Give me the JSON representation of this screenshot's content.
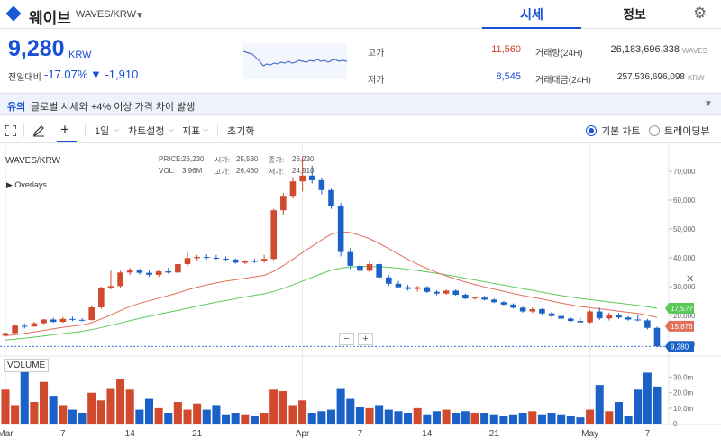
{
  "header": {
    "coin_name": "웨이브",
    "pair": "WAVES/KRW",
    "tabs": [
      {
        "label": "시세"
      },
      {
        "label": "정보"
      }
    ],
    "icons": {
      "coin": "diamond-icon",
      "caret": "caret-down-icon",
      "settings": "gear-icon"
    }
  },
  "ticker": {
    "price": "9,280",
    "unit": "KRW",
    "change_label": "전일대비",
    "change_pct": "-17.07%",
    "change_abs": "▼ -1,910",
    "high_label": "고가",
    "high": "11,560",
    "low_label": "저가",
    "low": "8,545",
    "volume_label": "거래량(24H)",
    "volume": "26,183,696.338",
    "volume_unit": "WAVES",
    "amount_label": "거래대금(24H)",
    "amount": "257,536,696,098",
    "amount_unit": "KRW"
  },
  "notice": {
    "tag": "유의",
    "text": "글로벌 시세와 +4% 이상 가격 차이 발생"
  },
  "toolbar": {
    "interval": "1일",
    "chart_settings": "차트설정",
    "indicators": "지표",
    "reset": "초기화",
    "basic_chart": "기본 차트",
    "tradingview": "트레이딩뷰"
  },
  "legend": {
    "price_label": "PRICE:",
    "price": "26,230",
    "open_label": "시가:",
    "open": "25,530",
    "close_label": "종가:",
    "close": "26,230",
    "vol_label": "VOL:",
    "vol": "3.96M",
    "high_label": "고가:",
    "high": "26,460",
    "low_label": "저가:",
    "low": "24,910"
  },
  "chart_ui": {
    "symbol": "WAVES/KRW",
    "overlays": "▶ Overlays",
    "volume_tag": "VOLUME",
    "zoom_out": "−",
    "zoom_in": "+",
    "close": "✕"
  },
  "chart_data": {
    "type": "candlestick",
    "y_axis": {
      "ticks": [
        10000,
        20000,
        30000,
        40000,
        50000,
        60000,
        70000
      ],
      "tick_labels": [
        "10,000",
        "20,000",
        "30,000",
        "40,000",
        "50,000",
        "60,000",
        "70,000"
      ],
      "range": [
        7500,
        75000
      ]
    },
    "volume_axis": {
      "ticks": [
        10,
        20,
        30
      ],
      "tick_labels": [
        "10.0m",
        "20.0m",
        "30.0m"
      ],
      "range": [
        0,
        35
      ]
    },
    "x_axis": {
      "ticks": [
        {
          "day": 1,
          "label": "Mar"
        },
        {
          "day": 7,
          "label": "7"
        },
        {
          "day": 14,
          "label": "14"
        },
        {
          "day": 21,
          "label": "21"
        },
        {
          "day": 32,
          "label": "Apr"
        },
        {
          "day": 38,
          "label": "7"
        },
        {
          "day": 45,
          "label": "14"
        },
        {
          "day": 52,
          "label": "21"
        },
        {
          "day": 62,
          "label": "May"
        },
        {
          "day": 68,
          "label": "7"
        }
      ]
    },
    "badges": {
      "ma_green": "17,5??",
      "ma_red": "15,876",
      "last": "9,280"
    },
    "colors": {
      "up": "#d14a2e",
      "down": "#1a62c8",
      "ma_short": "#e0705a",
      "ma_long": "#5cc85c",
      "badge_last": "#1a62c8"
    },
    "candles": [
      {
        "o": 13000,
        "h": 14200,
        "l": 12600,
        "c": 13900,
        "v": 22
      },
      {
        "o": 13900,
        "h": 17000,
        "l": 13500,
        "c": 16500,
        "v": 12
      },
      {
        "o": 16400,
        "h": 17200,
        "l": 15500,
        "c": 16200,
        "v": 34
      },
      {
        "o": 16200,
        "h": 17800,
        "l": 16000,
        "c": 17300,
        "v": 14
      },
      {
        "o": 17300,
        "h": 18800,
        "l": 17000,
        "c": 18600,
        "v": 27
      },
      {
        "o": 18600,
        "h": 19200,
        "l": 17500,
        "c": 17800,
        "v": 18
      },
      {
        "o": 17800,
        "h": 19500,
        "l": 17400,
        "c": 18800,
        "v": 12
      },
      {
        "o": 18800,
        "h": 19600,
        "l": 18000,
        "c": 18500,
        "v": 9
      },
      {
        "o": 18500,
        "h": 19000,
        "l": 17900,
        "c": 18400,
        "v": 7
      },
      {
        "o": 18400,
        "h": 23500,
        "l": 18300,
        "c": 22800,
        "v": 20
      },
      {
        "o": 22800,
        "h": 30000,
        "l": 22300,
        "c": 29700,
        "v": 15
      },
      {
        "o": 29700,
        "h": 35500,
        "l": 29000,
        "c": 30200,
        "v": 23
      },
      {
        "o": 30200,
        "h": 35500,
        "l": 29500,
        "c": 34900,
        "v": 29
      },
      {
        "o": 34900,
        "h": 36500,
        "l": 34000,
        "c": 35600,
        "v": 22
      },
      {
        "o": 35600,
        "h": 36200,
        "l": 34200,
        "c": 34800,
        "v": 9
      },
      {
        "o": 34800,
        "h": 35500,
        "l": 33500,
        "c": 34100,
        "v": 16
      },
      {
        "o": 34100,
        "h": 35800,
        "l": 33400,
        "c": 35300,
        "v": 10
      },
      {
        "o": 35300,
        "h": 36500,
        "l": 34500,
        "c": 34900,
        "v": 7
      },
      {
        "o": 34900,
        "h": 38200,
        "l": 34300,
        "c": 37800,
        "v": 14
      },
      {
        "o": 37800,
        "h": 42000,
        "l": 37200,
        "c": 39900,
        "v": 9
      },
      {
        "o": 39900,
        "h": 41000,
        "l": 38800,
        "c": 40300,
        "v": 13
      },
      {
        "o": 40300,
        "h": 41200,
        "l": 39500,
        "c": 40000,
        "v": 9
      },
      {
        "o": 40000,
        "h": 41000,
        "l": 39300,
        "c": 39700,
        "v": 12
      },
      {
        "o": 39700,
        "h": 40500,
        "l": 39000,
        "c": 39400,
        "v": 6
      },
      {
        "o": 39400,
        "h": 39800,
        "l": 38000,
        "c": 38300,
        "v": 7
      },
      {
        "o": 38300,
        "h": 39200,
        "l": 37800,
        "c": 38900,
        "v": 6
      },
      {
        "o": 38900,
        "h": 39600,
        "l": 38200,
        "c": 38800,
        "v": 5
      },
      {
        "o": 38800,
        "h": 41000,
        "l": 38300,
        "c": 39600,
        "v": 7
      },
      {
        "o": 39600,
        "h": 57000,
        "l": 39200,
        "c": 56500,
        "v": 22
      },
      {
        "o": 56500,
        "h": 62500,
        "l": 55000,
        "c": 61500,
        "v": 21
      },
      {
        "o": 61500,
        "h": 68000,
        "l": 60500,
        "c": 66500,
        "v": 12
      },
      {
        "o": 66500,
        "h": 75000,
        "l": 63000,
        "c": 68500,
        "v": 15
      },
      {
        "o": 68500,
        "h": 72000,
        "l": 65800,
        "c": 66900,
        "v": 7
      },
      {
        "o": 66900,
        "h": 67500,
        "l": 62000,
        "c": 63500,
        "v": 8
      },
      {
        "o": 63500,
        "h": 64000,
        "l": 57000,
        "c": 57800,
        "v": 9
      },
      {
        "o": 57800,
        "h": 59000,
        "l": 40500,
        "c": 42000,
        "v": 23
      },
      {
        "o": 42000,
        "h": 43500,
        "l": 36000,
        "c": 37200,
        "v": 16
      },
      {
        "o": 37200,
        "h": 38500,
        "l": 34800,
        "c": 35500,
        "v": 11
      },
      {
        "o": 35500,
        "h": 39000,
        "l": 34900,
        "c": 37800,
        "v": 10
      },
      {
        "o": 37800,
        "h": 38500,
        "l": 32500,
        "c": 33200,
        "v": 12
      },
      {
        "o": 33200,
        "h": 34000,
        "l": 30200,
        "c": 31000,
        "v": 9
      },
      {
        "o": 31000,
        "h": 32000,
        "l": 29300,
        "c": 29800,
        "v": 8
      },
      {
        "o": 29800,
        "h": 30600,
        "l": 28600,
        "c": 29200,
        "v": 7
      },
      {
        "o": 29200,
        "h": 30300,
        "l": 28300,
        "c": 29800,
        "v": 10
      },
      {
        "o": 29800,
        "h": 30200,
        "l": 27800,
        "c": 28200,
        "v": 6
      },
      {
        "o": 28200,
        "h": 28800,
        "l": 27000,
        "c": 27600,
        "v": 8
      },
      {
        "o": 27600,
        "h": 29000,
        "l": 27200,
        "c": 28600,
        "v": 9
      },
      {
        "o": 28600,
        "h": 29000,
        "l": 26800,
        "c": 27200,
        "v": 7
      },
      {
        "o": 27200,
        "h": 27600,
        "l": 25600,
        "c": 25900,
        "v": 8
      },
      {
        "o": 25900,
        "h": 26600,
        "l": 25400,
        "c": 26200,
        "v": 7
      },
      {
        "o": 26200,
        "h": 26800,
        "l": 25200,
        "c": 25500,
        "v": 7
      },
      {
        "o": 25500,
        "h": 25900,
        "l": 24300,
        "c": 24600,
        "v": 6
      },
      {
        "o": 24600,
        "h": 25000,
        "l": 23400,
        "c": 23800,
        "v": 5
      },
      {
        "o": 23800,
        "h": 24200,
        "l": 22400,
        "c": 22700,
        "v": 6
      },
      {
        "o": 22700,
        "h": 23300,
        "l": 21000,
        "c": 21400,
        "v": 7
      },
      {
        "o": 21400,
        "h": 22800,
        "l": 20800,
        "c": 22200,
        "v": 8
      },
      {
        "o": 22200,
        "h": 22500,
        "l": 20300,
        "c": 20700,
        "v": 6
      },
      {
        "o": 20700,
        "h": 21200,
        "l": 19400,
        "c": 19800,
        "v": 7
      },
      {
        "o": 19800,
        "h": 20200,
        "l": 18600,
        "c": 18900,
        "v": 6
      },
      {
        "o": 18900,
        "h": 19300,
        "l": 17800,
        "c": 18100,
        "v": 5
      },
      {
        "o": 18100,
        "h": 19000,
        "l": 17500,
        "c": 17600,
        "v": 4
      },
      {
        "o": 17600,
        "h": 22000,
        "l": 17300,
        "c": 21400,
        "v": 9
      },
      {
        "o": 21400,
        "h": 22700,
        "l": 18400,
        "c": 19000,
        "v": 25
      },
      {
        "o": 19000,
        "h": 21000,
        "l": 18300,
        "c": 20200,
        "v": 8
      },
      {
        "o": 20200,
        "h": 20800,
        "l": 18800,
        "c": 19300,
        "v": 14
      },
      {
        "o": 19300,
        "h": 19800,
        "l": 18200,
        "c": 18600,
        "v": 5
      },
      {
        "o": 18600,
        "h": 20300,
        "l": 18000,
        "c": 18300,
        "v": 22
      },
      {
        "o": 18300,
        "h": 18800,
        "l": 15200,
        "c": 15700,
        "v": 33
      },
      {
        "o": 15700,
        "h": 16100,
        "l": 9000,
        "c": 9280,
        "v": 24
      }
    ],
    "ma_short": [
      13000,
      13300,
      13800,
      14300,
      14800,
      15400,
      15900,
      16300,
      16700,
      17500,
      18800,
      20200,
      21700,
      23100,
      24200,
      25100,
      26000,
      26900,
      27800,
      28900,
      29800,
      30600,
      31300,
      31900,
      32400,
      32900,
      33400,
      33900,
      35300,
      37300,
      39500,
      41800,
      44000,
      46200,
      48200,
      49000,
      48800,
      47800,
      46600,
      45000,
      43200,
      41300,
      39500,
      37800,
      36300,
      34900,
      33700,
      32600,
      31600,
      30700,
      29900,
      29100,
      28400,
      27600,
      26900,
      26300,
      25700,
      25000,
      24300,
      23700,
      23100,
      22700,
      22300,
      21900,
      21500,
      21100,
      20700,
      20100,
      19300
    ],
    "ma_long": [
      11500,
      11800,
      12100,
      12500,
      12900,
      13300,
      13700,
      14100,
      14500,
      15100,
      15800,
      16600,
      17400,
      18200,
      19000,
      19700,
      20400,
      21100,
      21800,
      22500,
      23200,
      23900,
      24600,
      25200,
      25800,
      26400,
      27000,
      27500,
      28300,
      29400,
      30600,
      31900,
      33200,
      34500,
      35700,
      36400,
      36800,
      37000,
      37000,
      36900,
      36700,
      36400,
      36000,
      35600,
      35100,
      34600,
      34100,
      33500,
      32900,
      32300,
      31700,
      31100,
      30500,
      29900,
      29300,
      28700,
      28100,
      27500,
      26900,
      26400,
      25900,
      25500,
      25100,
      24700,
      24300,
      23900,
      23500,
      23000,
      22500
    ]
  }
}
